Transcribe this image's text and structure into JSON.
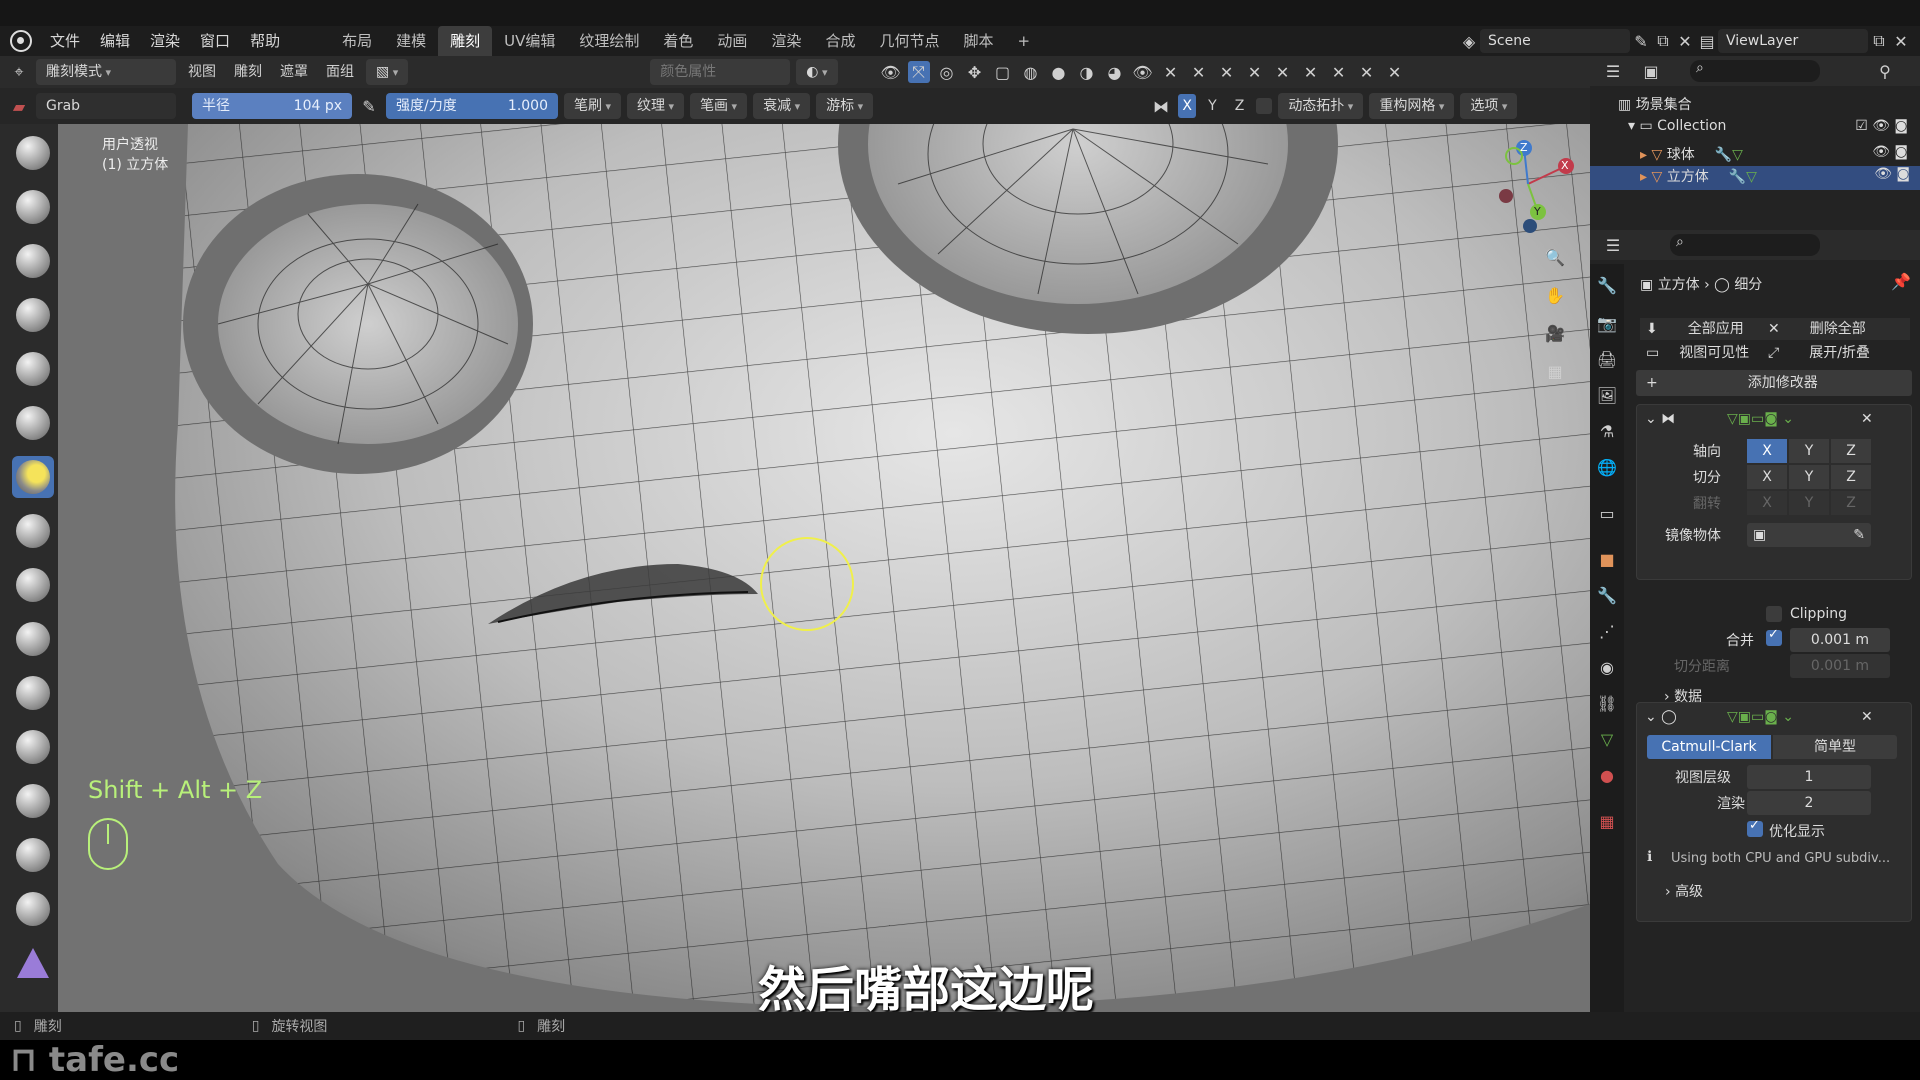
{
  "menubar": {
    "menus": [
      "文件",
      "编辑",
      "渲染",
      "窗口",
      "帮助"
    ],
    "workspaces": [
      "布局",
      "建模",
      "雕刻",
      "UV编辑",
      "纹理绘制",
      "着色",
      "动画",
      "渲染",
      "合成",
      "几何节点",
      "脚本"
    ],
    "active_workspace": "雕刻",
    "add_tab": "+",
    "scene": "Scene",
    "view_layer": "ViewLayer"
  },
  "header1": {
    "mode": "雕刻模式",
    "menus": [
      "视图",
      "雕刻",
      "遮罩",
      "面组"
    ],
    "color_attr": "颜色属性"
  },
  "header2": {
    "brush_name": "Grab",
    "radius_label": "半径",
    "radius_value": "104 px",
    "strength_label": "强度/力度",
    "strength_value": "1.000",
    "strength_fraction": 1.0,
    "dropdowns": [
      "笔刷",
      "纹理",
      "笔画",
      "衰减",
      "游标"
    ],
    "axes": [
      "X",
      "Y",
      "Z"
    ],
    "dyntopo": "动态拓扑",
    "remesh": "重构网格",
    "options": "选项"
  },
  "viewport": {
    "view_name": "用户透视",
    "object_name": "(1) 立方体",
    "shortcut": "Shift + Alt + Z",
    "subtitle": "然后嘴部这边呢",
    "gizmo": {
      "x": "X",
      "y": "Y",
      "z": "Z"
    }
  },
  "outliner": {
    "root": "场景集合",
    "collection": "Collection",
    "objects": [
      "球体",
      "立方体"
    ],
    "selected": "立方体"
  },
  "properties": {
    "breadcrumb_object": "立方体",
    "breadcrumb_modifier": "细分",
    "apply_all": "全部应用",
    "delete_all": "删除全部",
    "viewport_vis": "视图可见性",
    "expand_collapse": "展开/折叠",
    "add_modifier": "添加修改器",
    "mirror": {
      "axis_label": "轴向",
      "bisect_label": "切分",
      "flip_label": "翻转",
      "axes": [
        "X",
        "Y",
        "Z"
      ],
      "mirror_object_label": "镜像物体",
      "clipping_label": "Clipping",
      "merge_label": "合并",
      "merge_value": "0.001 m",
      "bisect_distance_label": "切分距离",
      "bisect_distance_value": "0.001 m",
      "data_label": "数据"
    },
    "subsurf": {
      "catmull": "Catmull-Clark",
      "simple": "简单型",
      "levels_viewport_label": "视图层级",
      "levels_viewport": "1",
      "render_label": "渲染",
      "render_levels": "2",
      "optimal_label": "优化显示",
      "info": "Using both CPU and GPU subdiv...",
      "advanced": "高级"
    }
  },
  "statusbar": {
    "left": "雕刻",
    "middle": "旋转视图",
    "right": "雕刻"
  },
  "watermark": "tafe.cc",
  "colors": {
    "accent": "#4772b3",
    "panel": "#232323",
    "header": "#2b2b2b",
    "brush_circle": "#f0f04a",
    "shortcut_text": "#b8f07a"
  }
}
